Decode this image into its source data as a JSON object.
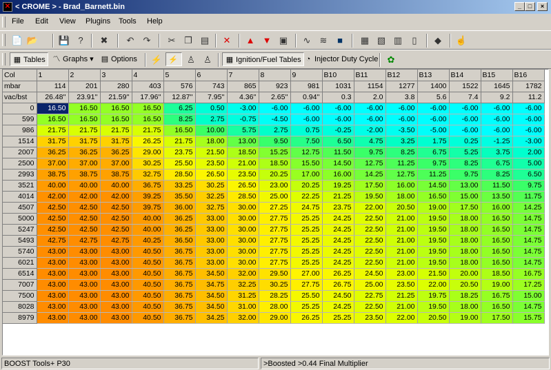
{
  "window": {
    "title": "< CROME > - Brad_Barnett.bin",
    "minimize": "_",
    "maximize": "□",
    "close": "×"
  },
  "menu": [
    "File",
    "Edit",
    "View",
    "Plugins",
    "Tools",
    "Help"
  ],
  "toolbar2": {
    "tables": "Tables",
    "graphs": "Graphs",
    "options": "Options",
    "ignition_fuel": "Ignition/Fuel Tables",
    "injector": "Injector Duty Cycle"
  },
  "table": {
    "header_row": [
      "Col",
      "1",
      "2",
      "3",
      "4",
      "5",
      "6",
      "7",
      "8",
      "9",
      "B10",
      "B11",
      "B12",
      "B13",
      "B14",
      "B15",
      "B16"
    ],
    "mbar_row": [
      "mbar",
      "114",
      "201",
      "280",
      "403",
      "576",
      "743",
      "865",
      "923",
      "981",
      "1031",
      "1154",
      "1277",
      "1400",
      "1522",
      "1645",
      "1782"
    ],
    "vac_row": [
      "vac/bst",
      "26.48''",
      "23.91''",
      "21.59''",
      "17.96''",
      "12.87''",
      "7.95''",
      "4.36''",
      "2.65''",
      "0.94''",
      "0.3",
      "2.0",
      "3.8",
      "5.6",
      "7.4",
      "9.2",
      "11.2"
    ],
    "rows": [
      {
        "rpm": "0",
        "v": [
          "16.50",
          "16.50",
          "16.50",
          "16.50",
          "6.25",
          "0.50",
          "-3.00",
          "-6.00",
          "-6.00",
          "-6.00",
          "-6.00",
          "-6.00",
          "-6.00",
          "-6.00",
          "-6.00",
          "-6.00"
        ]
      },
      {
        "rpm": "599",
        "v": [
          "16.50",
          "16.50",
          "16.50",
          "16.50",
          "8.25",
          "2.75",
          "-0.75",
          "-4.50",
          "-6.00",
          "-6.00",
          "-6.00",
          "-6.00",
          "-6.00",
          "-6.00",
          "-6.00",
          "-6.00"
        ]
      },
      {
        "rpm": "986",
        "v": [
          "21.75",
          "21.75",
          "21.75",
          "21.75",
          "16.50",
          "10.00",
          "5.75",
          "2.75",
          "0.75",
          "-0.25",
          "-2.00",
          "-3.50",
          "-5.00",
          "-6.00",
          "-6.00",
          "-6.00"
        ]
      },
      {
        "rpm": "1514",
        "v": [
          "31.75",
          "31.75",
          "31.75",
          "26.25",
          "21.75",
          "18.00",
          "13.00",
          "9.50",
          "7.50",
          "6.50",
          "4.75",
          "3.25",
          "1.75",
          "0.25",
          "-1.25",
          "-3.00"
        ]
      },
      {
        "rpm": "2007",
        "v": [
          "36.25",
          "36.25",
          "36.25",
          "29.00",
          "23.75",
          "21.50",
          "18.50",
          "15.25",
          "12.75",
          "11.50",
          "9.75",
          "8.25",
          "6.75",
          "5.25",
          "3.75",
          "2.00"
        ]
      },
      {
        "rpm": "2500",
        "v": [
          "37.00",
          "37.00",
          "37.00",
          "30.25",
          "25.50",
          "23.50",
          "21.00",
          "18.50",
          "15.50",
          "14.50",
          "12.75",
          "11.25",
          "9.75",
          "8.25",
          "6.75",
          "5.00"
        ]
      },
      {
        "rpm": "2993",
        "v": [
          "38.75",
          "38.75",
          "38.75",
          "32.75",
          "28.50",
          "26.50",
          "23.50",
          "20.25",
          "17.00",
          "16.00",
          "14.25",
          "12.75",
          "11.25",
          "9.75",
          "8.25",
          "6.50"
        ]
      },
      {
        "rpm": "3521",
        "v": [
          "40.00",
          "40.00",
          "40.00",
          "36.75",
          "33.25",
          "30.25",
          "26.50",
          "23.00",
          "20.25",
          "19.25",
          "17.50",
          "16.00",
          "14.50",
          "13.00",
          "11.50",
          "9.75"
        ]
      },
      {
        "rpm": "4014",
        "v": [
          "42.00",
          "42.00",
          "42.00",
          "39.25",
          "35.50",
          "32.25",
          "28.50",
          "25.00",
          "22.25",
          "21.25",
          "19.50",
          "18.00",
          "16.50",
          "15.00",
          "13.50",
          "11.75"
        ]
      },
      {
        "rpm": "4507",
        "v": [
          "42.50",
          "42.50",
          "42.50",
          "39.75",
          "36.00",
          "32.75",
          "30.00",
          "27.25",
          "24.75",
          "23.75",
          "22.00",
          "20.50",
          "19.00",
          "17.50",
          "16.00",
          "14.25"
        ]
      },
      {
        "rpm": "5000",
        "v": [
          "42.50",
          "42.50",
          "42.50",
          "40.00",
          "36.25",
          "33.00",
          "30.00",
          "27.75",
          "25.25",
          "24.25",
          "22.50",
          "21.00",
          "19.50",
          "18.00",
          "16.50",
          "14.75"
        ]
      },
      {
        "rpm": "5247",
        "v": [
          "42.50",
          "42.50",
          "42.50",
          "40.00",
          "36.25",
          "33.00",
          "30.00",
          "27.75",
          "25.25",
          "24.25",
          "22.50",
          "21.00",
          "19.50",
          "18.00",
          "16.50",
          "14.75"
        ]
      },
      {
        "rpm": "5493",
        "v": [
          "42.75",
          "42.75",
          "42.75",
          "40.25",
          "36.50",
          "33.00",
          "30.00",
          "27.75",
          "25.25",
          "24.25",
          "22.50",
          "21.00",
          "19.50",
          "18.00",
          "16.50",
          "14.75"
        ]
      },
      {
        "rpm": "5740",
        "v": [
          "43.00",
          "43.00",
          "43.00",
          "40.50",
          "36.75",
          "33.00",
          "30.00",
          "27.75",
          "25.25",
          "24.25",
          "22.50",
          "21.00",
          "19.50",
          "18.00",
          "16.50",
          "14.75"
        ]
      },
      {
        "rpm": "6021",
        "v": [
          "43.00",
          "43.00",
          "43.00",
          "40.50",
          "36.75",
          "33.00",
          "30.00",
          "27.75",
          "25.25",
          "24.25",
          "22.50",
          "21.00",
          "19.50",
          "18.00",
          "16.50",
          "14.75"
        ]
      },
      {
        "rpm": "6514",
        "v": [
          "43.00",
          "43.00",
          "43.00",
          "40.50",
          "36.75",
          "34.50",
          "32.00",
          "29.50",
          "27.00",
          "26.25",
          "24.50",
          "23.00",
          "21.50",
          "20.00",
          "18.50",
          "16.75"
        ]
      },
      {
        "rpm": "7007",
        "v": [
          "43.00",
          "43.00",
          "43.00",
          "40.50",
          "36.75",
          "34.75",
          "32.25",
          "30.25",
          "27.75",
          "26.75",
          "25.00",
          "23.50",
          "22.00",
          "20.50",
          "19.00",
          "17.25"
        ]
      },
      {
        "rpm": "7500",
        "v": [
          "43.00",
          "43.00",
          "43.00",
          "40.50",
          "36.75",
          "34.50",
          "31.25",
          "28.25",
          "25.50",
          "24.50",
          "22.75",
          "21.25",
          "19.75",
          "18.25",
          "16.75",
          "15.00"
        ]
      },
      {
        "rpm": "8028",
        "v": [
          "43.00",
          "43.00",
          "43.00",
          "40.50",
          "36.75",
          "34.50",
          "31.00",
          "28.00",
          "25.25",
          "24.25",
          "22.50",
          "21.00",
          "19.50",
          "18.00",
          "16.50",
          "14.75"
        ]
      },
      {
        "rpm": "8979",
        "v": [
          "43.00",
          "43.00",
          "43.00",
          "40.50",
          "36.75",
          "34.25",
          "32.00",
          "29.00",
          "26.25",
          "25.25",
          "23.50",
          "22.00",
          "20.50",
          "19.00",
          "17.50",
          "15.75"
        ]
      }
    ]
  },
  "status": {
    "left": "BOOST Tools+ P30",
    "right": ">Boosted >0.44 Final Multiplier"
  }
}
